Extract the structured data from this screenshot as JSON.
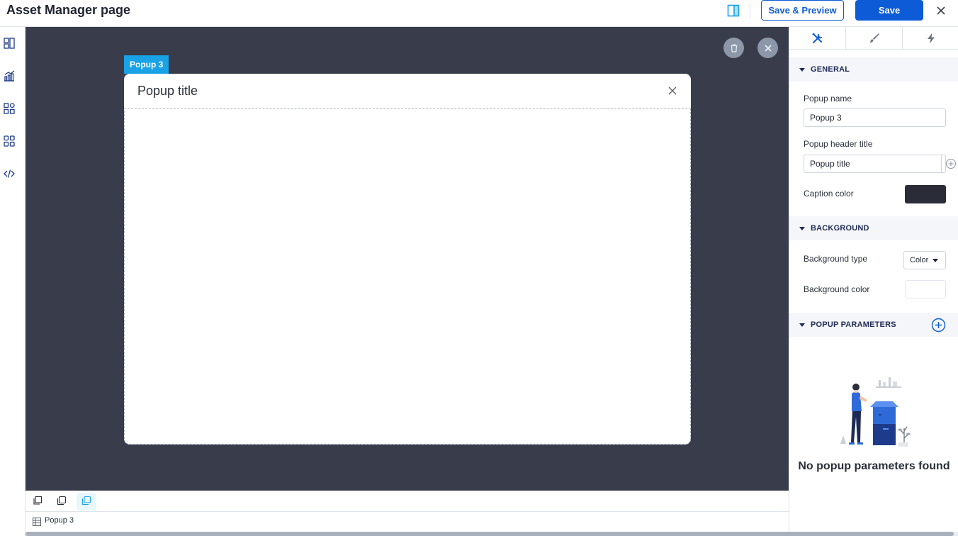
{
  "header": {
    "title": "Asset Manager page",
    "save_preview_label": "Save & Preview",
    "save_label": "Save"
  },
  "left_rail": {
    "items": [
      {
        "icon": "layout-icon"
      },
      {
        "icon": "chart-icon"
      },
      {
        "icon": "widgets-icon"
      },
      {
        "icon": "apps-grid-icon"
      },
      {
        "icon": "code-icon"
      }
    ]
  },
  "canvas": {
    "popup_tag": "Popup 3",
    "popup_title": "Popup title"
  },
  "bottom": {
    "crumb_label": "Popup 3"
  },
  "panel": {
    "tabs": [
      {
        "icon": "tools-icon",
        "active": true
      },
      {
        "icon": "brush-icon",
        "active": false
      },
      {
        "icon": "lightning-icon",
        "active": false
      }
    ],
    "general": {
      "title": "GENERAL",
      "popup_name_label": "Popup name",
      "popup_name_value": "Popup 3",
      "header_title_label": "Popup header title",
      "header_title_value": "Popup title",
      "caption_color_label": "Caption color",
      "caption_color": "#2a2d38"
    },
    "background": {
      "title": "BACKGROUND",
      "type_label": "Background type",
      "type_value": "Color",
      "color_label": "Background color",
      "color": "#ffffff"
    },
    "parameters": {
      "title": "POPUP PARAMETERS",
      "empty_text": "No popup parameters found"
    }
  },
  "colors": {
    "accent": "#0d5bd7",
    "tag": "#1aa2e6",
    "canvas_bg": "#393c4a"
  }
}
